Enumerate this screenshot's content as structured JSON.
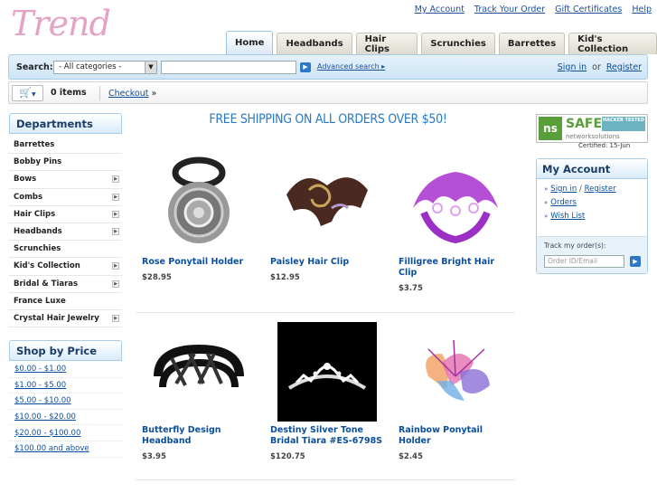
{
  "header": {
    "logo": "Trend",
    "top_links": [
      "My Account",
      "Track Your Order",
      "Gift Certificates",
      "Help"
    ]
  },
  "tabs": [
    {
      "label": "Home",
      "active": true
    },
    {
      "label": "Headbands",
      "active": false
    },
    {
      "label": "Hair Clips",
      "active": false
    },
    {
      "label": "Scrunchies",
      "active": false
    },
    {
      "label": "Barrettes",
      "active": false
    },
    {
      "label": "Kid's Collection",
      "active": false
    }
  ],
  "search": {
    "label": "Search:",
    "category_value": "- All categories -",
    "query_value": "",
    "advanced_label": "Advanced search"
  },
  "auth": {
    "signin": "Sign in",
    "or": "or",
    "register": "Register"
  },
  "cart": {
    "count": "0 items",
    "checkout": "Checkout"
  },
  "departments": {
    "title": "Departments",
    "items": [
      {
        "label": "Barrettes",
        "sub": false
      },
      {
        "label": "Bobby Pins",
        "sub": false
      },
      {
        "label": "Bows",
        "sub": true
      },
      {
        "label": "Combs",
        "sub": true
      },
      {
        "label": "Hair Clips",
        "sub": true
      },
      {
        "label": "Headbands",
        "sub": true
      },
      {
        "label": "Scrunchies",
        "sub": false
      },
      {
        "label": "Kid's Collection",
        "sub": true
      },
      {
        "label": "Bridal & Tiaras",
        "sub": true
      },
      {
        "label": "France Luxe",
        "sub": false
      },
      {
        "label": "Crystal Hair Jewelry",
        "sub": true
      }
    ]
  },
  "shop_by_price": {
    "title": "Shop by Price",
    "items": [
      "$0.00 - $1.00",
      "$1.00 - $5.00",
      "$5.00 - $10.00",
      "$10.00 - $20.00",
      "$20.00 - $100.00",
      "$100.00 and above"
    ]
  },
  "promo": "FREE SHIPPING ON ALL ORDERS OVER $50!",
  "products": [
    {
      "name": "Rose Ponytail Holder",
      "price": "$28.95"
    },
    {
      "name": "Paisley Hair Clip",
      "price": "$12.95"
    },
    {
      "name": "Filligree Bright Hair Clip",
      "price": "$3.75"
    },
    {
      "name": "Butterfly Design Headband",
      "price": "$3.95"
    },
    {
      "name": "Destiny Silver Tone Bridal Tiara #ES-6798S",
      "price": "$120.75"
    },
    {
      "name": "Rainbow Ponytail Holder",
      "price": "$2.45"
    }
  ],
  "badge": {
    "ns": "ns",
    "safe": "SAFE",
    "hacker": "HACKER TESTED",
    "network": "networksolutions",
    "certified": "Certified: 15-Jun"
  },
  "account": {
    "title": "My Account",
    "signin": "Sign in",
    "slash": "/",
    "register": "Register",
    "orders": "Orders",
    "wishlist": "Wish List",
    "track_label": "Track my order(s):",
    "track_placeholder": "Order ID/Email"
  }
}
